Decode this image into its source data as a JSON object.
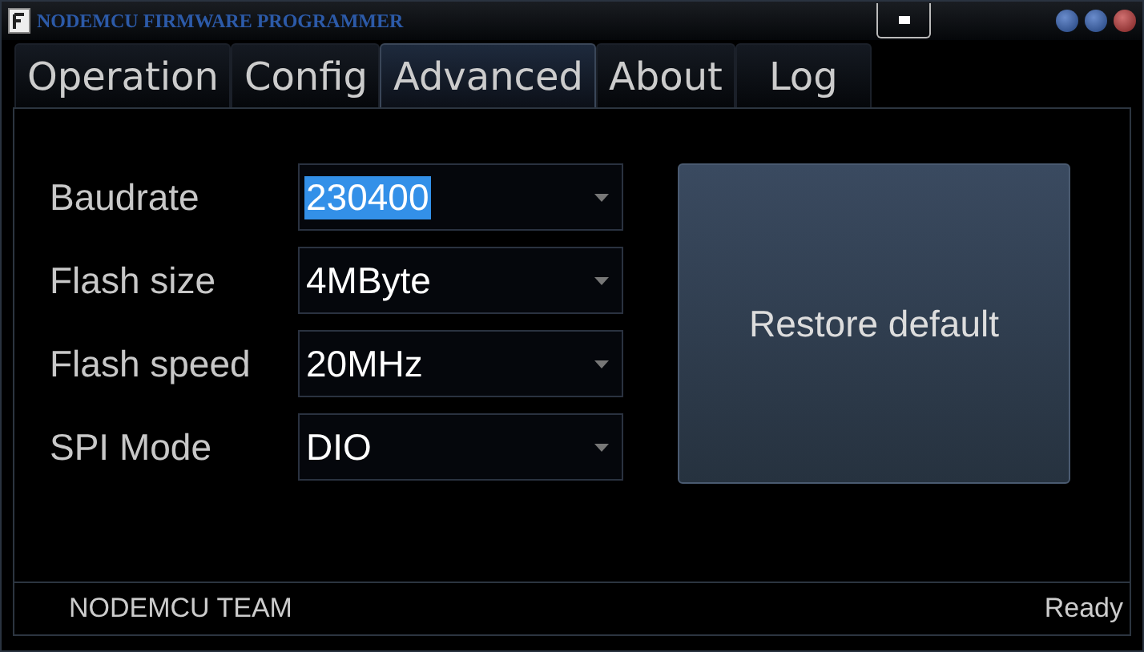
{
  "window": {
    "title": "NODEMCU FIRMWARE PROGRAMMER"
  },
  "tabs": [
    {
      "label": "Operation",
      "selected": false
    },
    {
      "label": "Config",
      "selected": false
    },
    {
      "label": "Advanced",
      "selected": true
    },
    {
      "label": "About",
      "selected": false
    },
    {
      "label": "Log",
      "selected": false
    }
  ],
  "settings": [
    {
      "label": "Baudrate",
      "value": "230400",
      "highlighted": true
    },
    {
      "label": "Flash size",
      "value": "4MByte",
      "highlighted": false
    },
    {
      "label": "Flash speed",
      "value": "20MHz",
      "highlighted": false
    },
    {
      "label": "SPI Mode",
      "value": "DIO",
      "highlighted": false
    }
  ],
  "restore_button": "Restore default",
  "status_bar": {
    "left": "NODEMCU TEAM",
    "right": "Ready"
  }
}
